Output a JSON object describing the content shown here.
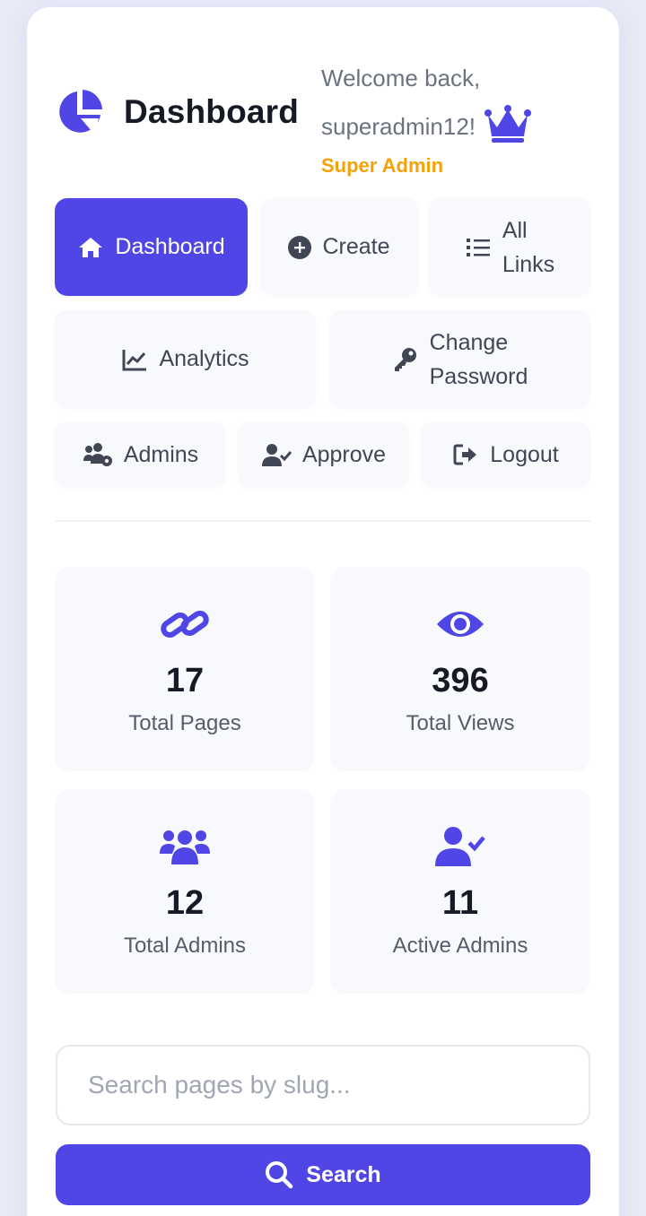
{
  "header": {
    "title": "Dashboard",
    "welcome_line1": "Welcome back,",
    "username": "superadmin12!",
    "role": "Super Admin"
  },
  "nav": {
    "dashboard": "Dashboard",
    "create": "Create",
    "all_links_1": "All",
    "all_links_2": "Links",
    "analytics": "Analytics",
    "change_password_1": "Change",
    "change_password_2": "Password",
    "admins": "Admins",
    "approve": "Approve",
    "logout": "Logout"
  },
  "stats": [
    {
      "value": "17",
      "label": "Total Pages",
      "icon": "link-icon"
    },
    {
      "value": "396",
      "label": "Total Views",
      "icon": "eye-icon"
    },
    {
      "value": "12",
      "label": "Total Admins",
      "icon": "users-icon"
    },
    {
      "value": "11",
      "label": "Active Admins",
      "icon": "user-check-icon"
    }
  ],
  "search": {
    "placeholder": "Search pages by slug...",
    "button_label": "Search"
  },
  "colors": {
    "accent": "#4f46e5",
    "role": "#f5a10a"
  }
}
